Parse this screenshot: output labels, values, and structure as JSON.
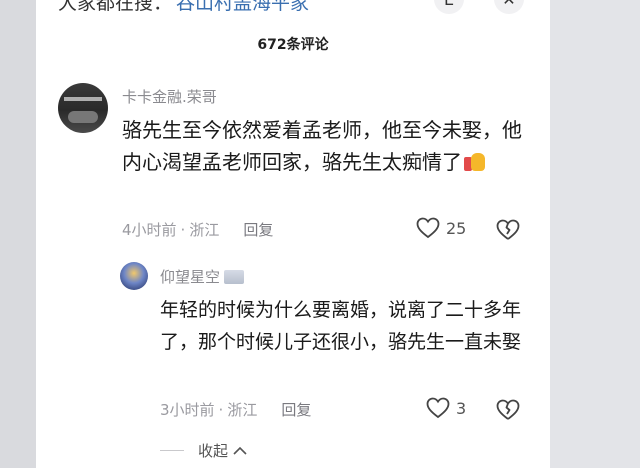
{
  "top_strip": {
    "text": "大家都在搜：",
    "highlight": "吞山村盖海平家",
    "btn_left": "E",
    "btn_right": "✕"
  },
  "comments_header": {
    "count_label": "672条评论"
  },
  "comments": [
    {
      "username": "卡卡金融.荣哥",
      "text": "骆先生至今依然爱着孟老师，他至今未娶，他内心渴望孟老师回家，骆先生太痴情了",
      "emoji": "thumbs-up",
      "time": "4小时前",
      "location": "浙江",
      "reply_label": "回复",
      "likes": "25"
    },
    {
      "username": "仰望星空",
      "text": "年轻的时候为什么要离婚，说离了二十多年了，那个时候儿子还很小，骆先生一直未娶",
      "time": "3小时前",
      "location": "浙江",
      "reply_label": "回复",
      "likes": "3"
    }
  ],
  "collapse_label": "收起",
  "collapse_icon": "chevron-up-icon",
  "icons": [
    "heart-icon",
    "broken-heart-icon",
    "chevron-up-icon"
  ]
}
